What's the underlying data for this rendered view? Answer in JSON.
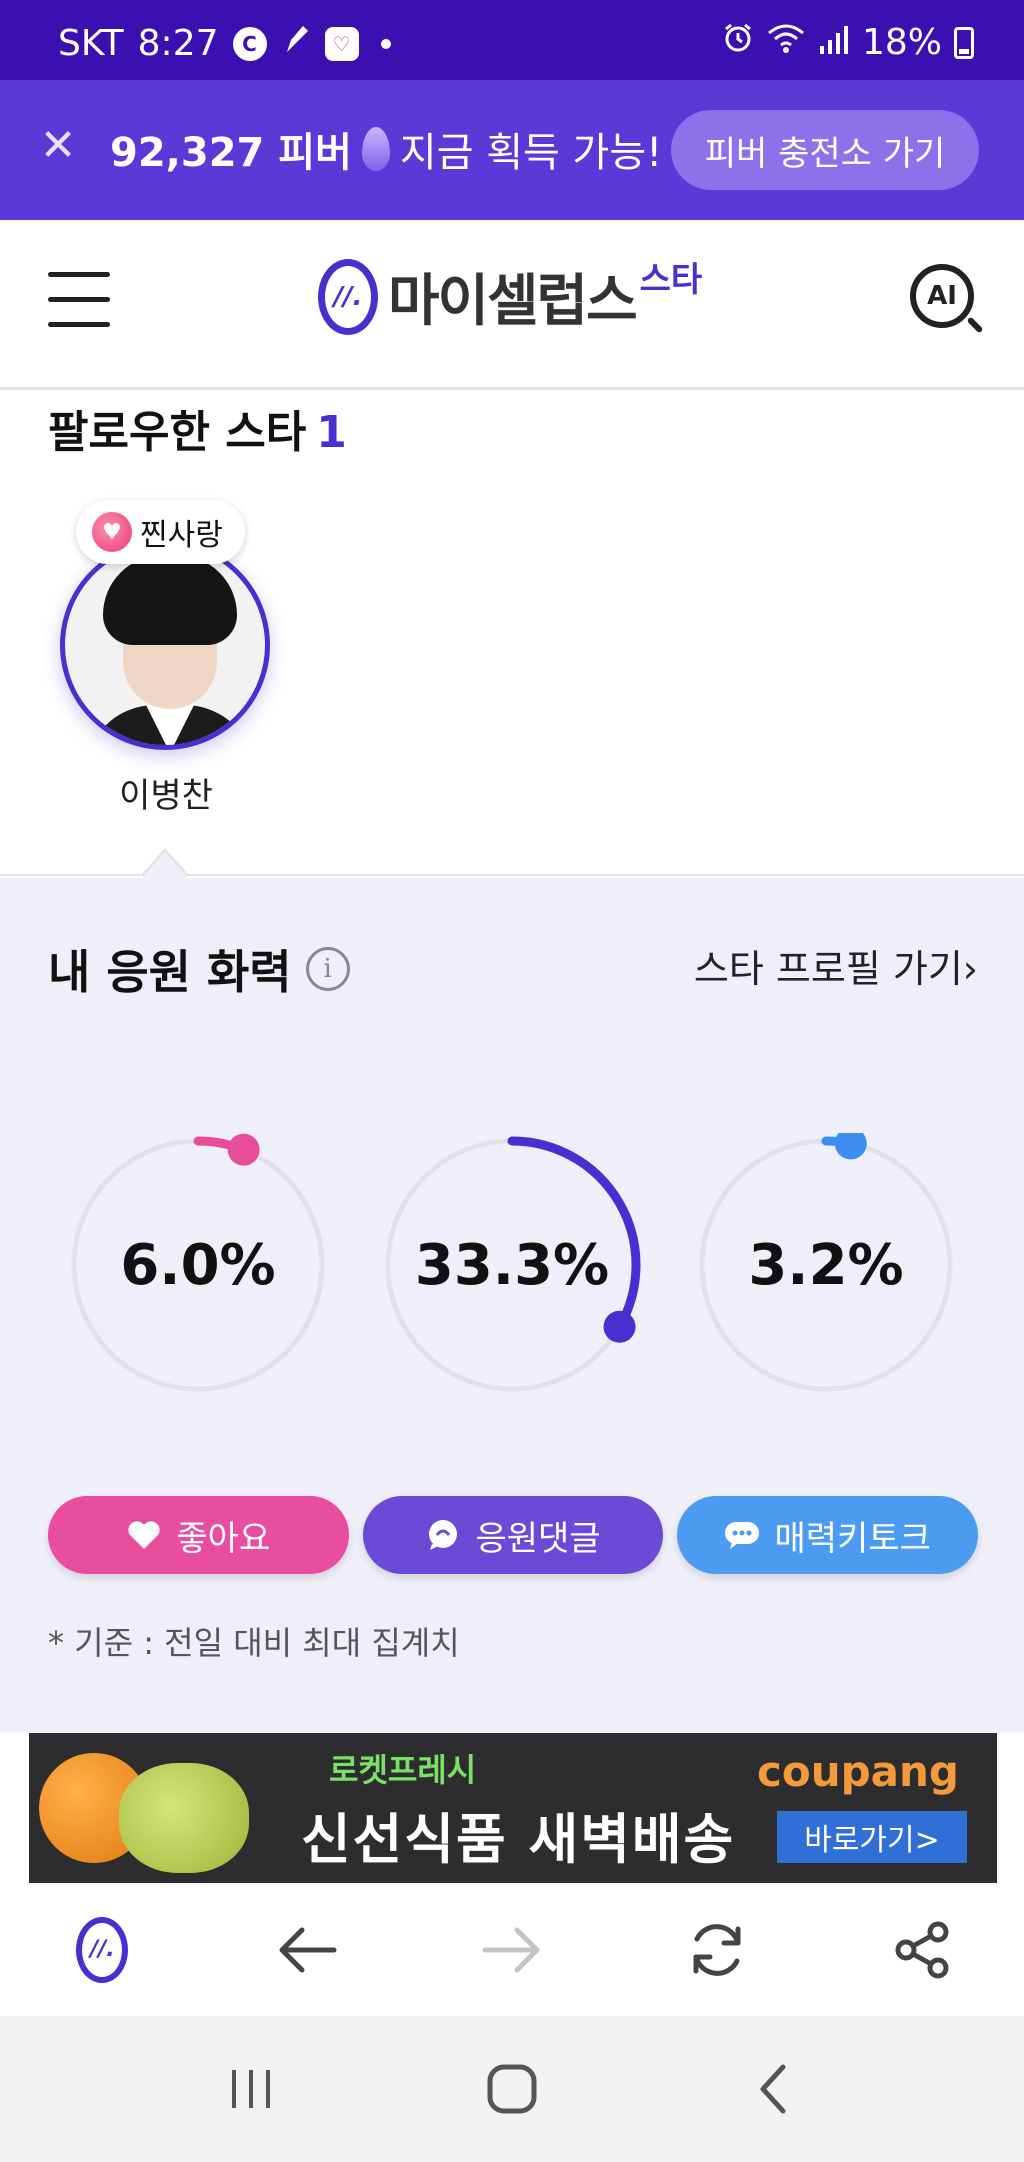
{
  "status_bar": {
    "carrier": "SKT",
    "time": "8:27",
    "battery": "18%",
    "icons": [
      "c-app-icon",
      "pen-app-icon",
      "heart-app-icon",
      "notification-dot",
      "alarm-icon",
      "wifi-icon",
      "signal-icon",
      "battery-icon"
    ]
  },
  "promo": {
    "amount": "92,327 피버",
    "message": "지금 획득 가능!",
    "cta": "피버 충전소 가기"
  },
  "header": {
    "logo_mark": "//.",
    "logo_text": "마이셀럽스",
    "logo_sup": "스타",
    "ai_label": "AI"
  },
  "followed": {
    "title": "팔로우한 스타",
    "count": "1",
    "stars": [
      {
        "name": "이병찬",
        "badge": "찐사랑"
      }
    ]
  },
  "power": {
    "title": "내 응원 화력",
    "link": "스타 프로필 가기",
    "link_chevron": "›",
    "rings": [
      {
        "label": "6.0%",
        "value": 6.0,
        "color": "#e84d9c"
      },
      {
        "label": "33.3%",
        "value": 33.3,
        "color": "#4a2fd0"
      },
      {
        "label": "3.2%",
        "value": 3.2,
        "color": "#3d8ef0"
      }
    ],
    "buttons": [
      {
        "label": "좋아요",
        "icon": "heart-icon",
        "color": "#e84da0"
      },
      {
        "label": "응원댓글",
        "icon": "chat-bubble-icon",
        "color": "#6a4ad6"
      },
      {
        "label": "매력키토크",
        "icon": "talk-bubble-icon",
        "color": "#4b9bf0"
      }
    ],
    "note": "* 기준 : 전일 대비 최대 집계치"
  },
  "ad": {
    "tag": "로켓프레시",
    "headline": "신선식품 새벽배송",
    "brand": "coupang",
    "cta": "바로가기>"
  },
  "toolbar": {
    "items": [
      "home-logo-icon",
      "back-arrow-icon",
      "forward-arrow-icon",
      "refresh-icon",
      "share-icon"
    ]
  },
  "system_nav": {
    "items": [
      "recent-apps-icon",
      "home-icon",
      "back-icon"
    ]
  }
}
